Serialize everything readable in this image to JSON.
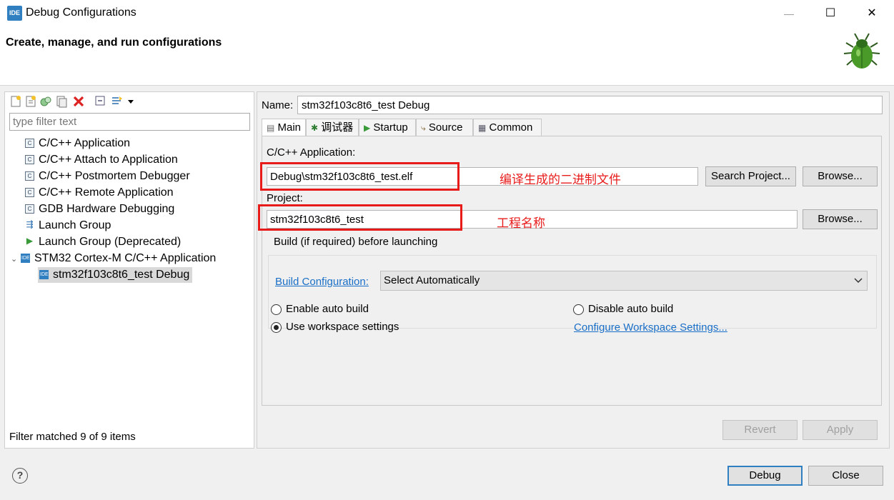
{
  "window": {
    "app_icon": "IDE",
    "title": "Debug Configurations",
    "minimize": "—",
    "maximize": "☐",
    "close": "✕"
  },
  "header": {
    "title": "Create, manage, and run configurations",
    "icon": "bug-icon"
  },
  "left_panel": {
    "toolbar_icons": [
      "new-config-icon",
      "new-prototype-icon",
      "duplicate-icon",
      "export-icon",
      "delete-icon",
      "collapse-all-icon",
      "filter-icon",
      "dropdown-arrow-icon"
    ],
    "filter_placeholder": "type filter text",
    "tree": [
      {
        "label": "C/C++ Application",
        "icon": "c-app-icon"
      },
      {
        "label": "C/C++ Attach to Application",
        "icon": "c-app-icon"
      },
      {
        "label": "C/C++ Postmortem Debugger",
        "icon": "c-app-icon"
      },
      {
        "label": "C/C++ Remote Application",
        "icon": "c-app-icon"
      },
      {
        "label": "GDB Hardware Debugging",
        "icon": "c-app-icon"
      },
      {
        "label": "Launch Group",
        "icon": "launch-group-icon"
      },
      {
        "label": "Launch Group (Deprecated)",
        "icon": "run-icon"
      },
      {
        "label": "STM32 Cortex-M C/C++ Application",
        "icon": "ide-icon",
        "expanded": true
      },
      {
        "label": "stm32f103c8t6_test Debug",
        "icon": "ide-icon",
        "selected": true
      }
    ],
    "status": "Filter matched 9 of 9 items"
  },
  "right_panel": {
    "name_label": "Name:",
    "name_value": "stm32f103c8t6_test Debug",
    "tabs": [
      {
        "label": "Main",
        "icon": "main-tab-icon"
      },
      {
        "label": "调试器",
        "icon": "debugger-tab-icon"
      },
      {
        "label": "Startup",
        "icon": "startup-tab-icon"
      },
      {
        "label": "Source",
        "icon": "source-tab-icon"
      },
      {
        "label": "Common",
        "icon": "common-tab-icon"
      }
    ],
    "app_label": "C/C++ Application:",
    "app_value": "Debug\\stm32f103c8t6_test.elf",
    "app_annotation": "编译生成的二进制文件",
    "search_project": "Search Project...",
    "browse": "Browse...",
    "project_label": "Project:",
    "project_value": "stm32f103c8t6_test",
    "project_annotation": "工程名称",
    "build_group_label": "Build (if required) before launching",
    "build_config_link": "Build Configuration:",
    "build_config_value": "Select Automatically",
    "enable_auto_build": "Enable auto build",
    "disable_auto_build": "Disable auto build",
    "use_workspace": "Use workspace settings",
    "configure_workspace": "Configure Workspace Settings...",
    "selected_radio": "use_workspace",
    "revert": "Revert",
    "apply": "Apply"
  },
  "footer": {
    "help": "?",
    "debug": "Debug",
    "close": "Close"
  }
}
